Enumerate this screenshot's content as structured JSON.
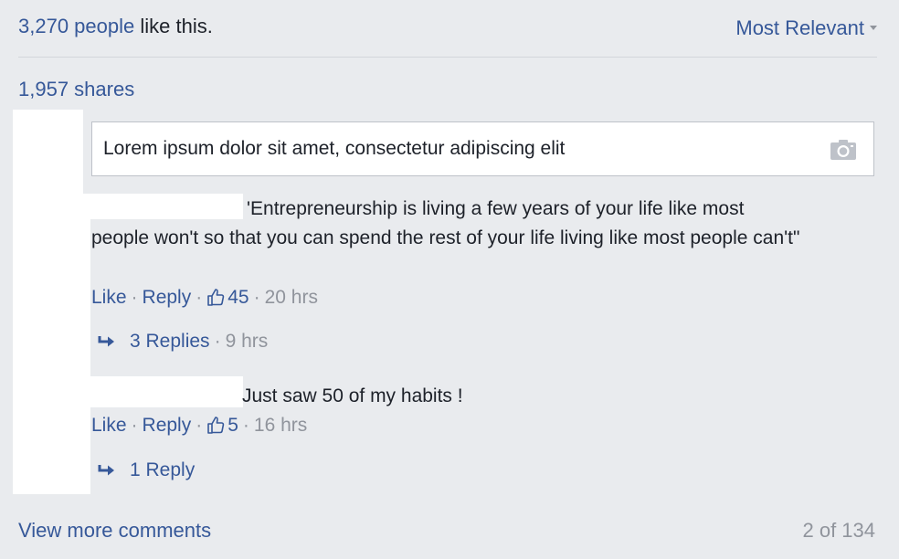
{
  "summary": {
    "likes_count": "3,270 people",
    "likes_suffix": " like this.",
    "sort_label": "Most Relevant",
    "shares": "1,957 shares"
  },
  "composer": {
    "text": "Lorem ipsum dolor sit amet, consectetur adipiscing elit",
    "camera_icon": "camera-icon"
  },
  "comments": [
    {
      "text_line1": "'Entrepreneurship is living a few years of your life like most",
      "text_rest": "people won't so that you can spend the rest of your life living like most people can't\"",
      "like_label": "Like",
      "reply_label": "Reply",
      "reactions": "45",
      "time": "20 hrs",
      "replies_label": "3 Replies",
      "replies_time": "9 hrs"
    },
    {
      "text": "Just saw 50 of my habits !",
      "like_label": "Like",
      "reply_label": "Reply",
      "reactions": "5",
      "time": "16 hrs",
      "replies_label": "1 Reply"
    }
  ],
  "footer": {
    "view_more": "View more comments",
    "pager": "2 of 134"
  },
  "colors": {
    "link": "#365899",
    "muted": "#90949c",
    "background": "#e9ebee"
  }
}
